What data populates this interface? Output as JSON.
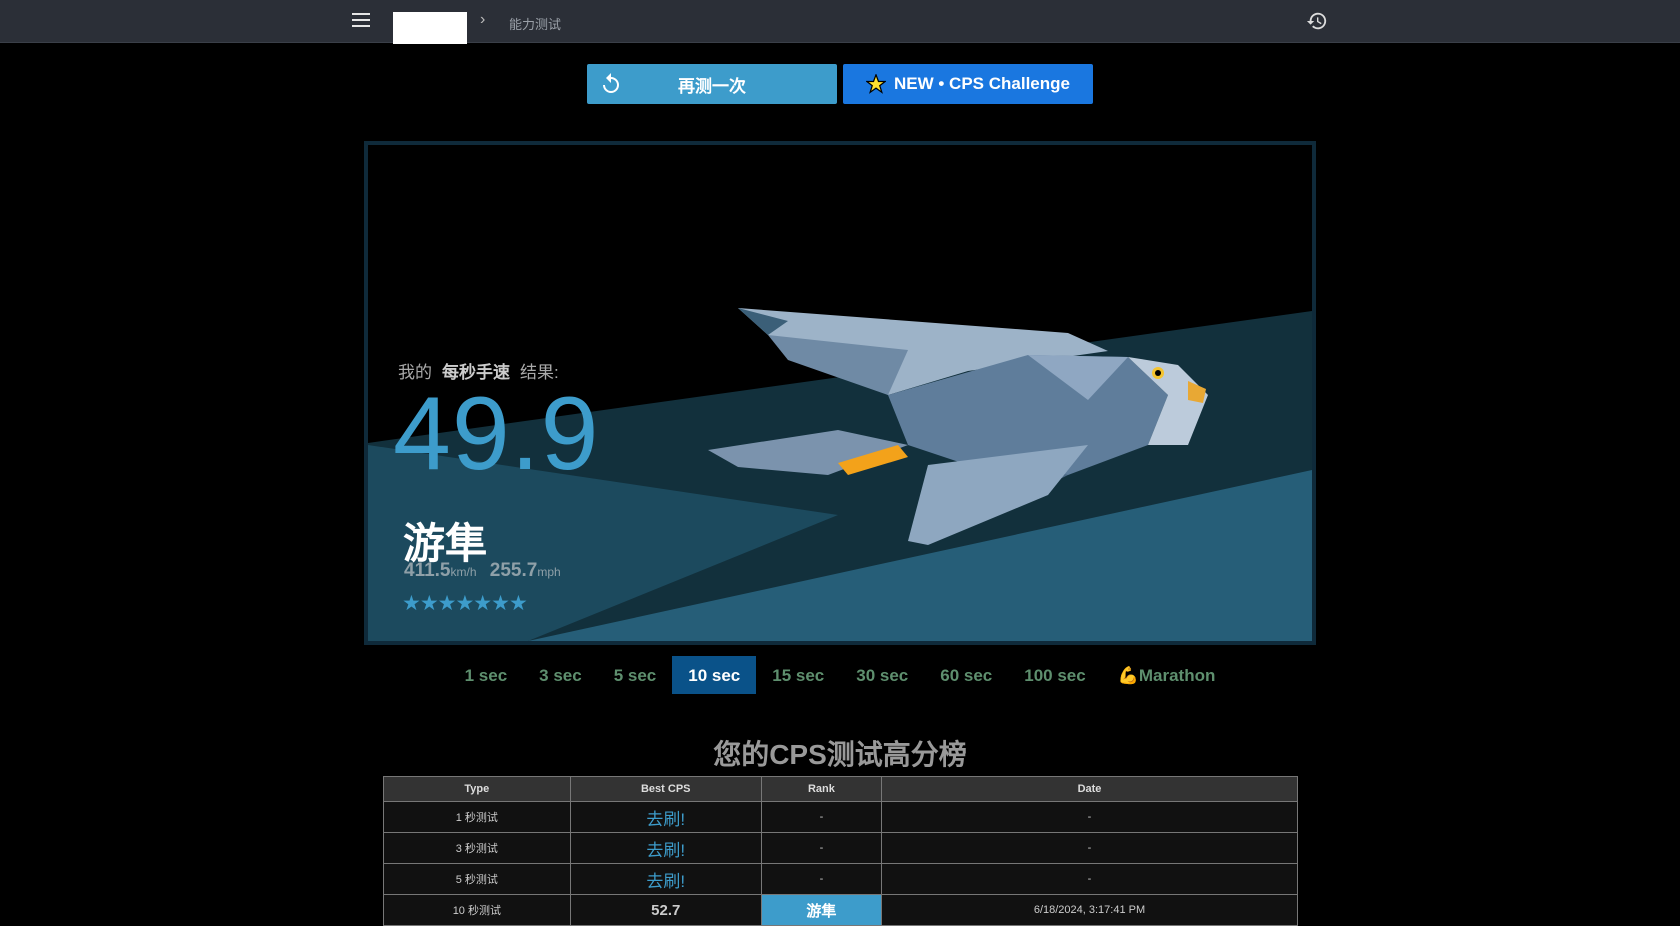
{
  "header": {
    "breadcrumb_current": "能力测试"
  },
  "actions": {
    "retry_label": "再测一次",
    "cps_label": "NEW • CPS Challenge"
  },
  "result": {
    "prefix": "我的",
    "metric": "每秒手速",
    "suffix": "结果:",
    "score": "49.9",
    "animal": "游隼",
    "kmh": "411.5",
    "kmh_unit": "km/h",
    "mph": "255.7",
    "mph_unit": "mph",
    "stars": "★★★★★★★"
  },
  "tabs": [
    "1 sec",
    "3 sec",
    "5 sec",
    "10 sec",
    "15 sec",
    "30 sec",
    "60 sec",
    "100 sec",
    "💪Marathon"
  ],
  "active_tab": 3,
  "leaderboard": {
    "title": "您的CPS测试高分榜",
    "headers": [
      "Type",
      "Best CPS",
      "Rank",
      "Date"
    ],
    "rows": [
      {
        "type": "1 秒测试",
        "best": "去刷!",
        "rank": "-",
        "date": "-"
      },
      {
        "type": "3 秒测试",
        "best": "去刷!",
        "rank": "-",
        "date": "-"
      },
      {
        "type": "5 秒测试",
        "best": "去刷!",
        "rank": "-",
        "date": "-"
      },
      {
        "type": "10 秒测试",
        "best": "52.7",
        "rank": "游隼",
        "date": "6/18/2024, 3:17:41 PM"
      }
    ]
  },
  "colors": {
    "accent": "#3d9ccb",
    "topbar": "#2b2f37",
    "cps_button": "#1a77e0",
    "tab_active": "#0a5289",
    "tab_text": "#5e8f6e"
  }
}
